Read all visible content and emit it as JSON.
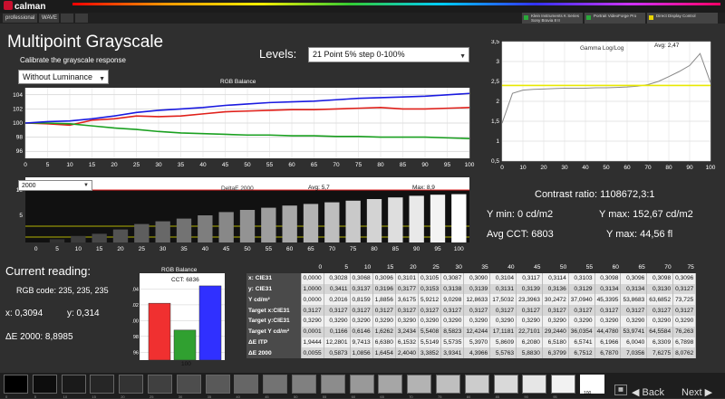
{
  "app": {
    "name": "calman",
    "tabs": [
      "professional",
      "WAVE",
      "",
      "",
      ""
    ]
  },
  "devices": [
    {
      "line1": "Klein Instruments K Series",
      "line2": "Sony Bravia 8 II",
      "led": "#2aa83a"
    },
    {
      "line1": "Portrait VideoForge Pro",
      "line2": "",
      "led": "#2aa83a"
    },
    {
      "line1": "Direct Display Control",
      "line2": "",
      "led": "#e8d400"
    }
  ],
  "page": {
    "title": "Multipoint Grayscale",
    "subtitle": "Calibrate the grayscale response",
    "levels_label": "Levels:"
  },
  "luminance_select": {
    "value": "Without Luminance"
  },
  "levels_select": {
    "value": "21 Point 5% step 0-100%"
  },
  "rgb_balance": {
    "title": "RGB Balance",
    "y_ticks": [
      "104",
      "102",
      "100",
      "98",
      "96"
    ],
    "x_ticks": [
      "0",
      "5",
      "10",
      "15",
      "20",
      "25",
      "30",
      "35",
      "40",
      "45",
      "50",
      "55",
      "60",
      "65",
      "70",
      "75",
      "80",
      "85",
      "90",
      "95",
      "100"
    ]
  },
  "chart_data": [
    {
      "type": "line",
      "title": "RGB Balance",
      "x": [
        0,
        5,
        10,
        15,
        20,
        25,
        30,
        35,
        40,
        45,
        50,
        55,
        60,
        65,
        70,
        75,
        80,
        85,
        90,
        95,
        100
      ],
      "ylim": [
        95,
        105
      ],
      "series": [
        {
          "color": "#e0201a",
          "values": [
            100.0,
            99.9,
            99.7,
            100.4,
            100.6,
            101.0,
            100.9,
            101.0,
            101.3,
            101.6,
            101.7,
            101.8,
            101.9,
            101.9,
            102.0,
            102.1,
            102.2,
            102.0,
            102.0,
            102.1,
            102.2
          ]
        },
        {
          "color": "#1aa020",
          "values": [
            100.0,
            100.0,
            99.9,
            99.6,
            99.3,
            99.1,
            98.8,
            98.6,
            98.5,
            98.4,
            98.3,
            98.3,
            98.2,
            98.2,
            98.1,
            98.1,
            98.0,
            98.0,
            98.0,
            97.9,
            97.8
          ]
        },
        {
          "color": "#1a1ae0",
          "values": [
            100.0,
            100.2,
            100.3,
            100.6,
            101.0,
            101.5,
            101.8,
            102.0,
            102.2,
            102.5,
            102.7,
            102.9,
            103.0,
            103.1,
            103.3,
            103.5,
            103.6,
            103.7,
            103.8,
            104.0,
            104.2
          ]
        }
      ]
    },
    {
      "type": "bar",
      "title": "DeltaE 2000",
      "categories": [
        "0",
        "5",
        "10",
        "15",
        "20",
        "25",
        "30",
        "35",
        "40",
        "45",
        "50",
        "55",
        "60",
        "65",
        "70",
        "75",
        "80",
        "85",
        "90",
        "95",
        "100"
      ],
      "values": [
        0.0,
        0.6,
        1.2,
        1.6,
        2.4,
        3.4,
        3.9,
        4.4,
        5.0,
        5.6,
        6.0,
        6.4,
        6.8,
        7.1,
        7.4,
        7.7,
        8.0,
        8.3,
        8.6,
        8.8,
        8.9
      ],
      "ylim": [
        0,
        10
      ]
    },
    {
      "type": "line",
      "title": "Gamma Log/Log",
      "x": [
        0,
        5,
        10,
        15,
        20,
        25,
        30,
        35,
        40,
        45,
        50,
        55,
        60,
        65,
        70,
        75,
        80,
        85,
        90,
        95,
        100
      ],
      "ylim": [
        0.5,
        3.5
      ],
      "series": [
        {
          "name": "Gamma",
          "color": "#888888",
          "values": [
            1.45,
            2.2,
            2.28,
            2.3,
            2.31,
            2.32,
            2.33,
            2.33,
            2.33,
            2.34,
            2.34,
            2.35,
            2.36,
            2.38,
            2.42,
            2.5,
            2.62,
            2.75,
            2.9,
            3.2,
            2.47
          ]
        },
        {
          "name": "Target",
          "color": "#e8e800",
          "values": [
            2.4,
            2.4,
            2.4,
            2.4,
            2.4,
            2.4,
            2.4,
            2.4,
            2.4,
            2.4,
            2.4,
            2.4,
            2.4,
            2.4,
            2.4,
            2.4,
            2.4,
            2.4,
            2.4,
            2.4,
            2.4
          ]
        }
      ]
    },
    {
      "type": "bar",
      "title": "RGB Balance",
      "categories": [
        "R",
        "G",
        "B"
      ],
      "values": [
        102.2,
        98.8,
        104.4
      ],
      "ylim": [
        95,
        106
      ]
    }
  ],
  "deltae_chart": {
    "title": "DeltaE 2000",
    "select": "2000",
    "avg": "Avg: 5,7",
    "max": "Max: 8,9",
    "y_ticks": [
      "10",
      "5"
    ]
  },
  "gamma_chart": {
    "title": "Gamma Log/Log",
    "avg": "Avg: 2,47",
    "y_ticks": [
      "3,5",
      "3",
      "2,5",
      "2",
      "1,5",
      "1",
      "0,5"
    ],
    "x_ticks": [
      "0",
      "10",
      "20",
      "30",
      "40",
      "50",
      "60",
      "70",
      "80",
      "90",
      "100"
    ]
  },
  "readings": {
    "contrast": "Contrast ratio: 1108672,3:1",
    "y_min": "Y min: 0 cd/m2",
    "y_max": "Y max: 152,67 cd/m2",
    "avg_cct": "Avg CCT: 6803",
    "y_max_fl": "Y max: 44,56 fl"
  },
  "current": {
    "title": "Current reading:",
    "rgb_code": "RGB code: 235, 235, 235",
    "x": "x: 0,3094",
    "y": "y: 0,314",
    "de": "ΔE 2000: 8,8985"
  },
  "mini_chart": {
    "title": "RGB Balance",
    "cct": "CCT: 6836",
    "x_label": "100",
    "y_ticks": [
      "104",
      "102",
      "100",
      "98",
      "96"
    ]
  },
  "table": {
    "headers": [
      "0",
      "5",
      "10",
      "15",
      "20",
      "25",
      "30",
      "35",
      "40",
      "45",
      "50",
      "55",
      "60",
      "65",
      "70",
      "75"
    ],
    "rows": [
      {
        "label": "x: CIE31",
        "cells": [
          "0,0000",
          "0,3028",
          "0,3068",
          "0,3096",
          "0,3101",
          "0,3105",
          "0,3087",
          "0,3090",
          "0,3104",
          "0,3117",
          "0,3114",
          "0,3103",
          "0,3098",
          "0,3096",
          "0,3098",
          "0,3096"
        ]
      },
      {
        "label": "y: CIE31",
        "cells": [
          "1,0000",
          "0,3411",
          "0,3137",
          "0,3196",
          "0,3177",
          "0,3153",
          "0,3138",
          "0,3139",
          "0,3131",
          "0,3139",
          "0,3136",
          "0,3129",
          "0,3134",
          "0,3134",
          "0,3130",
          "0,3127"
        ]
      },
      {
        "label": "Y cd/m²",
        "cells": [
          "0,0000",
          "0,2016",
          "0,8159",
          "1,8856",
          "3,6175",
          "5,9212",
          "9,0298",
          "12,8633",
          "17,5032",
          "23,3963",
          "30,2472",
          "37,0940",
          "45,3395",
          "53,8683",
          "63,6852",
          "73,725"
        ]
      },
      {
        "label": "Target x:CIE31",
        "cells": [
          "0,3127",
          "0,3127",
          "0,3127",
          "0,3127",
          "0,3127",
          "0,3127",
          "0,3127",
          "0,3127",
          "0,3127",
          "0,3127",
          "0,3127",
          "0,3127",
          "0,3127",
          "0,3127",
          "0,3127",
          "0,3127"
        ]
      },
      {
        "label": "Target y:CIE31",
        "cells": [
          "0,3290",
          "0,3290",
          "0,3290",
          "0,3290",
          "0,3290",
          "0,3290",
          "0,3290",
          "0,3290",
          "0,3290",
          "0,3290",
          "0,3290",
          "0,3290",
          "0,3290",
          "0,3290",
          "0,3290",
          "0,3290"
        ]
      },
      {
        "label": "Target Y cd/m²",
        "cells": [
          "0,0001",
          "0,1166",
          "0,6146",
          "1,6262",
          "3,2434",
          "5,5408",
          "8,5823",
          "12,4244",
          "17,1181",
          "22,7101",
          "29,2440",
          "36,0354",
          "44,4780",
          "53,9741",
          "64,5584",
          "76,263"
        ]
      },
      {
        "label": "ΔE ITP",
        "cells": [
          "1,9444",
          "12,2801",
          "9,7413",
          "6,6380",
          "6,1532",
          "5,5149",
          "5,5735",
          "5,3970",
          "5,8609",
          "6,2080",
          "6,5180",
          "6,5741",
          "6,1966",
          "6,0040",
          "6,3309",
          "6,7898"
        ]
      },
      {
        "label": "ΔE 2000",
        "cells": [
          "0,0055",
          "0,5873",
          "1,0856",
          "1,6454",
          "2,4040",
          "3,3852",
          "3,9341",
          "4,3966",
          "5,5763",
          "5,8830",
          "6,3799",
          "6,7512",
          "6,7870",
          "7,0356",
          "7,6275",
          "8,0762"
        ]
      }
    ]
  },
  "swatches": {
    "labels": [
      "0",
      "5",
      "10",
      "15",
      "20",
      "25",
      "30",
      "35",
      "40",
      "45",
      "50",
      "55",
      "60",
      "65",
      "70",
      "75",
      "80",
      "85",
      "90",
      "95",
      "100"
    ],
    "active_label": "100"
  },
  "nav": {
    "back": "Back",
    "next": "Next"
  }
}
